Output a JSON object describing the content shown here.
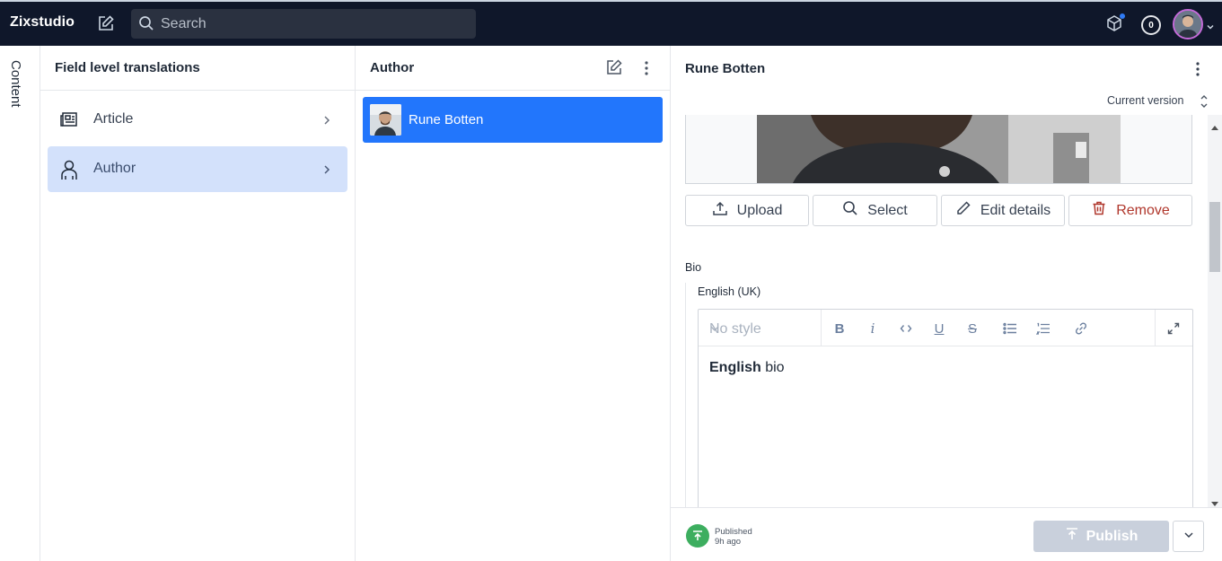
{
  "topbar": {
    "brand": "Zixstudio",
    "search_placeholder": "Search",
    "notification_count": "0"
  },
  "rail": {
    "label": "Content"
  },
  "pane1": {
    "title": "Field level translations",
    "items": [
      {
        "label": "Article",
        "icon": "newspaper-icon"
      },
      {
        "label": "Author",
        "icon": "user-icon",
        "active": true
      }
    ]
  },
  "pane2": {
    "title": "Author",
    "documents": [
      {
        "label": "Rune Botten"
      }
    ]
  },
  "pane3": {
    "title": "Rune Botten",
    "version": "Current version",
    "image_buttons": {
      "upload": "Upload",
      "select": "Select",
      "edit": "Edit details",
      "remove": "Remove"
    },
    "bio": {
      "label": "Bio",
      "language": "English (UK)",
      "style_placeholder": "No style",
      "content_bold": "English",
      "content_rest": " bio"
    },
    "footer": {
      "status": "Published",
      "time": "9h ago",
      "publish": "Publish"
    }
  },
  "colors": {
    "accent": "#2276fc",
    "active_nav": "#d3e1fb",
    "danger": "#b0372c",
    "published": "#3dae5f"
  }
}
